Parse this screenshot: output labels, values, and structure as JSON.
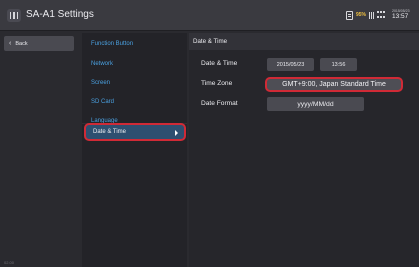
{
  "app": {
    "title": "SA-A1 Settings"
  },
  "status": {
    "battery_percent": "95%",
    "date": "2015/05/23",
    "time": "13:57"
  },
  "nav": {
    "back_label": "Back"
  },
  "menu": {
    "items": [
      {
        "label": "Function Button"
      },
      {
        "label": "Network"
      },
      {
        "label": "Screen"
      },
      {
        "label": "SD Card"
      },
      {
        "label": "Language"
      },
      {
        "label": "Date & Time",
        "selected": true
      }
    ]
  },
  "panel": {
    "title": "Date & Time",
    "rows": {
      "datetime": {
        "label": "Date & Time",
        "date_value": "2015/05/23",
        "time_value": "13:56"
      },
      "timezone": {
        "label": "Time Zone",
        "value": "GMT+9:00, Japan Standard Time"
      },
      "format": {
        "label": "Date Format",
        "value": "yyyy/MM/dd"
      }
    }
  },
  "footer": {
    "version": "02.00"
  },
  "colors": {
    "accent": "#4aa0e0",
    "highlight": "#d02a36",
    "selected_bg": "#2e4f70",
    "battery_text": "#f0c040"
  }
}
